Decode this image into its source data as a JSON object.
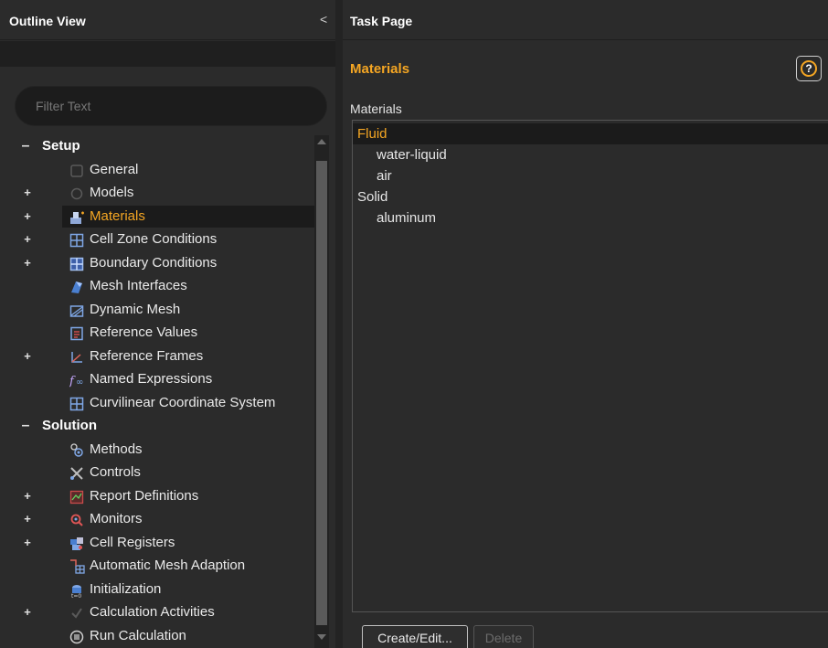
{
  "outline": {
    "title": "Outline View",
    "collapse_glyph": "<",
    "filter_placeholder": "Filter Text",
    "tree": [
      {
        "label": "Setup",
        "type": "section",
        "expander": "-",
        "icon": ""
      },
      {
        "label": "General",
        "type": "item",
        "expander": "",
        "icon": "general-icon"
      },
      {
        "label": "Models",
        "type": "item",
        "expander": "+",
        "icon": "models-icon"
      },
      {
        "label": "Materials",
        "type": "item",
        "expander": "+",
        "icon": "materials-icon",
        "selected": true
      },
      {
        "label": "Cell Zone Conditions",
        "type": "item",
        "expander": "+",
        "icon": "cell-zone-icon"
      },
      {
        "label": "Boundary Conditions",
        "type": "item",
        "expander": "+",
        "icon": "boundary-icon"
      },
      {
        "label": "Mesh Interfaces",
        "type": "item",
        "expander": "",
        "icon": "mesh-interfaces-icon"
      },
      {
        "label": "Dynamic Mesh",
        "type": "item",
        "expander": "",
        "icon": "dynamic-mesh-icon"
      },
      {
        "label": "Reference Values",
        "type": "item",
        "expander": "",
        "icon": "reference-values-icon"
      },
      {
        "label": "Reference Frames",
        "type": "item",
        "expander": "+",
        "icon": "reference-frames-icon"
      },
      {
        "label": "Named Expressions",
        "type": "item",
        "expander": "",
        "icon": "named-expressions-icon"
      },
      {
        "label": "Curvilinear Coordinate System",
        "type": "item",
        "expander": "",
        "icon": "curvilinear-icon"
      },
      {
        "label": "Solution",
        "type": "section",
        "expander": "-",
        "icon": ""
      },
      {
        "label": "Methods",
        "type": "item",
        "expander": "",
        "icon": "methods-icon"
      },
      {
        "label": "Controls",
        "type": "item",
        "expander": "",
        "icon": "controls-icon"
      },
      {
        "label": "Report Definitions",
        "type": "item",
        "expander": "+",
        "icon": "report-definitions-icon"
      },
      {
        "label": "Monitors",
        "type": "item",
        "expander": "+",
        "icon": "monitors-icon"
      },
      {
        "label": "Cell Registers",
        "type": "item",
        "expander": "+",
        "icon": "cell-registers-icon"
      },
      {
        "label": "Automatic Mesh Adaption",
        "type": "item",
        "expander": "",
        "icon": "mesh-adaption-icon"
      },
      {
        "label": "Initialization",
        "type": "item",
        "expander": "",
        "icon": "initialization-icon"
      },
      {
        "label": "Calculation Activities",
        "type": "item",
        "expander": "+",
        "icon": "calculation-activities-icon"
      },
      {
        "label": "Run Calculation",
        "type": "item",
        "expander": "",
        "icon": "run-calculation-icon"
      }
    ]
  },
  "task": {
    "title": "Task Page",
    "heading": "Materials",
    "help_glyph": "?",
    "list_label": "Materials",
    "materials": [
      {
        "label": "Fluid",
        "type": "category",
        "selected": true
      },
      {
        "label": "water-liquid",
        "type": "item"
      },
      {
        "label": "air",
        "type": "item"
      },
      {
        "label": "Solid",
        "type": "category"
      },
      {
        "label": "aluminum",
        "type": "item"
      }
    ],
    "buttons": {
      "create_edit": "Create/Edit...",
      "delete": "Delete"
    }
  },
  "colors": {
    "accent": "#f5a623",
    "background": "#2b2b2b",
    "selection": "#1b1b1b",
    "text": "#e6e6e6"
  }
}
